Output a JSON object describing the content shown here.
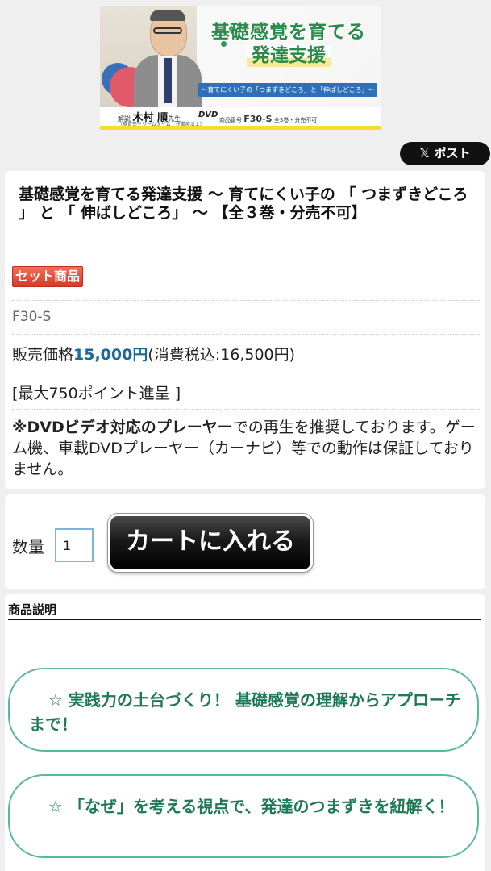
{
  "banner": {
    "title_line1": "基礎感覚を育てる",
    "title_line2": "発達支援",
    "subtitle": "～育てにくい子の「つまずきどころ」と「伸ばしどころ」～",
    "kaisetsu_label": "解説",
    "lecturer": "木村 順",
    "lecturer_suffix": "先生",
    "affiliation": "（療育塾ドリームタイム　作業療法士）",
    "dvd_mark": "DVD",
    "code_label": "商品番号",
    "code": "F30-S",
    "code_note": "全3巻・分売不可"
  },
  "share": {
    "x_glyph": "𝕏",
    "post_label": "ポスト"
  },
  "product": {
    "title": "基礎感覚を育てる発達支援 ～ 育てにくい子の 「 つまずきどころ 」 と 「 伸ばしどころ」 ～ 【全３巻・分売不可】",
    "badge": "セット商品",
    "sku": "F30-S",
    "price_label": "販売価格",
    "price": "15,000円",
    "price_tax": "(消費税込:16,500円)",
    "points": "[最大750ポイント進呈 ]",
    "notice_bold": "※DVDビデオ対応のプレーヤー",
    "notice_rest": "での再生を推奨しております。ゲーム機、車載DVDプレーヤー（カーナビ）等での動作は保証しておりません。"
  },
  "cart": {
    "qty_label": "数量",
    "qty_value": "1",
    "button_label": "カートに入れる"
  },
  "description": {
    "heading": "商品説明",
    "points": [
      "☆ 実践力の土台づくり！ 基礎感覚の理解からアプローチまで！",
      "☆ 「なぜ」を考える視点で、発達のつまずきを紐解く！"
    ]
  },
  "colors": {
    "price": "#1c6a9a",
    "badge": "#e04a35",
    "point_text": "#1e7a56",
    "point_border": "#5ab8a0"
  }
}
